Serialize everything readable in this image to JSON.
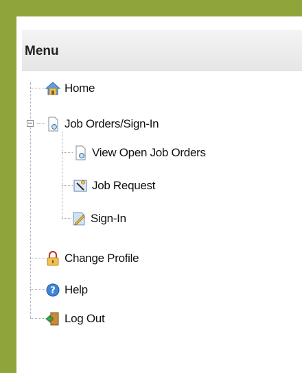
{
  "menu": {
    "title": "Menu",
    "items": [
      {
        "label": "Home",
        "icon": "home-icon"
      },
      {
        "label": "Job Orders/Sign-In",
        "icon": "document-search-icon",
        "expanded": true,
        "children": [
          {
            "label": "View Open Job Orders",
            "icon": "document-search-icon"
          },
          {
            "label": "Job Request",
            "icon": "request-icon"
          },
          {
            "label": "Sign-In",
            "icon": "pencil-document-icon"
          }
        ]
      },
      {
        "label": "Change Profile",
        "icon": "lock-icon"
      },
      {
        "label": "Help",
        "icon": "help-icon"
      },
      {
        "label": "Log Out",
        "icon": "exit-door-icon"
      }
    ]
  },
  "colors": {
    "frame": "#8fa53a",
    "panel": "#ffffff",
    "header": "#eeeeee"
  }
}
